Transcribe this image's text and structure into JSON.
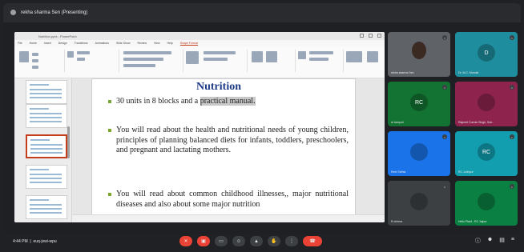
{
  "meet": {
    "presenter_label": "rekha sharma Sen (Presenting)",
    "meeting_time": "4:44 PM",
    "meeting_code": "euq-jvwi-wpu"
  },
  "ppt": {
    "window_title": "Nutrition.pptx - PowerPoint",
    "menu": [
      "File",
      "Home",
      "Insert",
      "Design",
      "Transitions",
      "Animations",
      "Slide Show",
      "Review",
      "View",
      "Help",
      "Shape Format"
    ],
    "active_menu_index": 10
  },
  "slide": {
    "title": "Nutrition",
    "bullets": [
      {
        "text": "30 units in 8 blocks and a ",
        "highlight": "practical manual."
      },
      {
        "text": "You will read about the health and nutritional needs of young children, principles of planning balanced diets for infants, toddlers, preschoolers, and pregnant and lactating mothers."
      },
      {
        "text": "You will read about common childhood illnesses,, major nutritional diseases and also about some major nutrition"
      }
    ],
    "colors": {
      "title": "#1f3c88",
      "bullet": "#78a52b",
      "highlight": "#c8c8c8"
    }
  },
  "participants": [
    {
      "name": "rekha sharma Sen",
      "initials": "",
      "bg": "#5f6368",
      "video": true
    },
    {
      "name": "Dr. M.C. Mondal",
      "initials": "D",
      "bg": "#1e8e9e",
      "video": false
    },
    {
      "name": "re tampuri",
      "initials": "RC",
      "bg": "#137333",
      "video": false
    },
    {
      "name": "Rajneet Cormic Singh, Soh..",
      "initials": "",
      "bg": "#8e244d",
      "video": false
    },
    {
      "name": "Reet Sethia",
      "initials": "",
      "bg": "#1a73e8",
      "video": false
    },
    {
      "name": "RC Jodhpur",
      "initials": "RC",
      "bg": "#129eaf",
      "video": false
    },
    {
      "name": "R chhera",
      "initials": "",
      "bg": "#3c4043",
      "video": false
    },
    {
      "name": "Hello Plant - RC Jaipur",
      "initials": "",
      "bg": "#0b8043",
      "video": false
    }
  ],
  "controls": {
    "mic_icon": "mic-off-icon",
    "camera_icon": "camera-off-icon",
    "end_call_icon": "end-call-icon"
  }
}
